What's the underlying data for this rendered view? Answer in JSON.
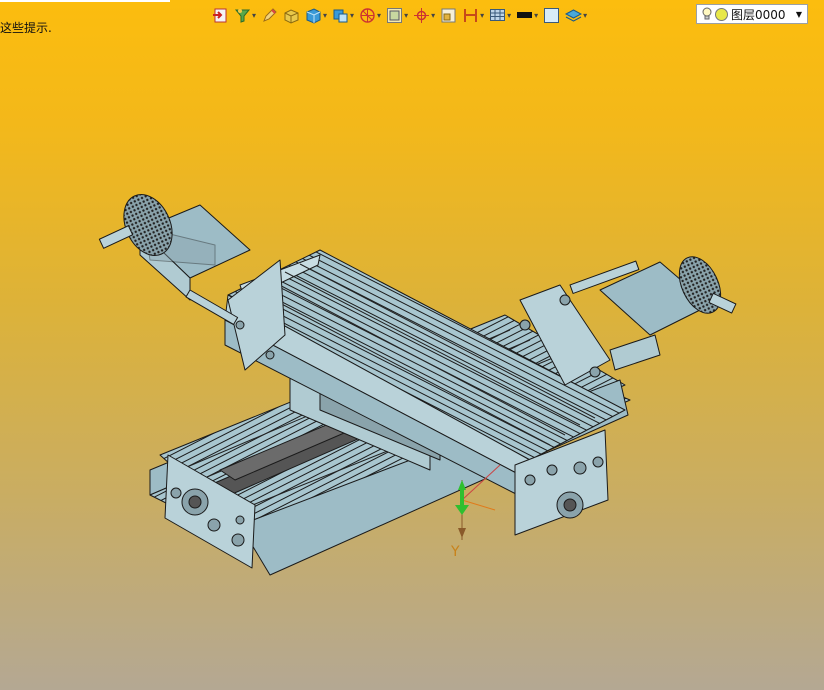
{
  "hint_text": "这些提示.",
  "layer": {
    "label": "图层0000"
  },
  "toolbar": {
    "icons": [
      "exit-icon",
      "filter-icon",
      "pencil-icon",
      "box-icon",
      "cube-icon",
      "view-icon",
      "wireframe-icon",
      "snap-icon",
      "crosshair-icon",
      "frame-icon",
      "section-icon",
      "grid-icon",
      "color-black-icon",
      "color-white-icon",
      "layer-stack-icon",
      "bulb-icon"
    ]
  },
  "axis": {
    "label": "Y"
  },
  "colors": {
    "background_top": "#fcbd0e",
    "background_bottom": "#b4a893",
    "part": "#a8c6cf",
    "edge": "#1a1a1a",
    "axis_y": "#2fbf2f"
  }
}
